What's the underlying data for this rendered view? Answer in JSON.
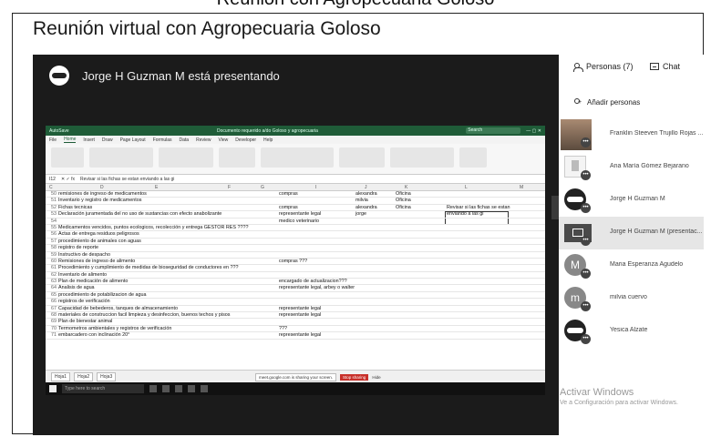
{
  "top_cut_text": "Reunión con Agropecuaria Goloso",
  "caption": "Reunión virtual con Agropecuaria Goloso",
  "meeting": {
    "presenter_text": "Jorge H Guzman M está presentando"
  },
  "excel": {
    "title": "Documento requerido a/do Goloso y agropecuaria",
    "search_placeholder": "Search",
    "menu": [
      "File",
      "Home",
      "Insert",
      "Draw",
      "Page Layout",
      "Formulas",
      "Data",
      "Review",
      "View",
      "Developer",
      "Help"
    ],
    "menu_selected": "Home",
    "formula_cell": "I12",
    "formula_text": "Revisar si las fichas se estan enviando a las gi",
    "columns": [
      "C",
      "D",
      "E",
      "F",
      "G",
      "I",
      "J",
      "K",
      "L",
      "M"
    ],
    "rows": [
      {
        "n": "50",
        "d": "remisiones de ingreso de medicamentos",
        "i": "compras",
        "j": "alexandra",
        "k": "Oficina",
        "l": ""
      },
      {
        "n": "51",
        "d": "Inventario y registro de medicamentos",
        "i": "",
        "j": "milvia",
        "k": "Oficina",
        "l": ""
      },
      {
        "n": "52",
        "d": "Fichas tecnicas",
        "i": "compras",
        "j": "alexandra",
        "k": "Oficina",
        "l": "Revisar si las fichas se estan"
      },
      {
        "n": "53",
        "d": "Declaración juramentada del no uso de sustancias con efecto anabolizante",
        "i": "representante legal",
        "j": "jorge",
        "k": "",
        "l": "enviando a las gi"
      },
      {
        "n": "54",
        "d": "",
        "i": "medico veterinario",
        "j": "",
        "k": "",
        "l": ""
      },
      {
        "n": "55",
        "d": "Medicamentos vencidos, puntos ecologicos, recolección y entrega GESTOR RES ????",
        "i": "",
        "j": "",
        "k": "",
        "l": ""
      },
      {
        "n": "56",
        "d": "Actas de entrega residuos peligrosos",
        "i": "",
        "j": "",
        "k": "",
        "l": ""
      },
      {
        "n": "57",
        "d": "procedimiento de animales con aguas",
        "i": "",
        "j": "",
        "k": "",
        "l": ""
      },
      {
        "n": "58",
        "d": "registro de reporte",
        "i": "",
        "j": "",
        "k": "",
        "l": ""
      },
      {
        "n": "59",
        "d": "Instructivo de despacho",
        "i": "",
        "j": "",
        "k": "",
        "l": ""
      },
      {
        "n": "60",
        "d": "Remisiones de ingreso de alimento",
        "i": "compras ???",
        "j": "",
        "k": "",
        "l": ""
      },
      {
        "n": "61",
        "d": "Procedimiento y cumplimiento de medidas de bioseguridad de conductores en ???",
        "i": "",
        "j": "",
        "k": "",
        "l": ""
      },
      {
        "n": "62",
        "d": "Inventario de alimento",
        "i": "",
        "j": "",
        "k": "",
        "l": ""
      },
      {
        "n": "63",
        "d": "Plan de medicación de alimento",
        "i": "encargado de actualizacion???",
        "j": "",
        "k": "",
        "l": ""
      },
      {
        "n": "64",
        "d": "Analisis de agua",
        "i": "representante legal, arbey o walter",
        "j": "",
        "k": "",
        "l": ""
      },
      {
        "n": "65",
        "d": "procedimiento de potabilizacion de agua",
        "i": "",
        "j": "",
        "k": "",
        "l": ""
      },
      {
        "n": "66",
        "d": "registros de verificación",
        "i": "",
        "j": "",
        "k": "",
        "l": ""
      },
      {
        "n": "67",
        "d": "Capacidad de bebederos, tanques de almacenamiento",
        "i": "representante legal",
        "j": "",
        "k": "",
        "l": ""
      },
      {
        "n": "68",
        "d": "materiales de construccion facil limpieza y desinfeccion, buenos techos y pisos",
        "i": "representante legal",
        "j": "",
        "k": "",
        "l": ""
      },
      {
        "n": "69",
        "d": "Plan de bienestar animal",
        "i": "",
        "j": "",
        "k": "",
        "l": ""
      },
      {
        "n": "70",
        "d": "Termometros ambientales y registros de verificación",
        "i": "???",
        "j": "",
        "k": "",
        "l": ""
      },
      {
        "n": "71",
        "d": "embarcadero con inclinación 20°",
        "i": "representante legal",
        "j": "",
        "k": "",
        "l": ""
      }
    ],
    "sheet_tabs": [
      "Hoja1",
      "Hoja2",
      "Hoja3"
    ],
    "share_message": "meet.google.com is sharing your screen.",
    "stop_sharing": "Stop sharing",
    "hide": "Hide",
    "taskbar_search": "Type here to search"
  },
  "panel": {
    "people_tab": "Personas (7)",
    "chat_tab": "Chat",
    "add_people": "Añadir personas",
    "participants": [
      {
        "name": "Franklin Steeven Trujillo Rojas ...",
        "avatar": "photo",
        "initial": ""
      },
      {
        "name": "Ana María Gómez Bejarano",
        "avatar": "doc",
        "initial": ""
      },
      {
        "name": "Jorge H Guzman M",
        "avatar": "logo",
        "initial": ""
      },
      {
        "name": "Jorge H Guzman M (presentac...",
        "avatar": "screen",
        "initial": ""
      },
      {
        "name": "Maria Esperanza Agudelo",
        "avatar": "letter",
        "initial": "M"
      },
      {
        "name": "milvia cuervo",
        "avatar": "letter",
        "initial": "m"
      },
      {
        "name": "Yesica Alzate",
        "avatar": "logo",
        "initial": ""
      }
    ]
  },
  "watermark": {
    "line1": "Activar Windows",
    "line2": "Ve a Configuración para activar Windows."
  }
}
